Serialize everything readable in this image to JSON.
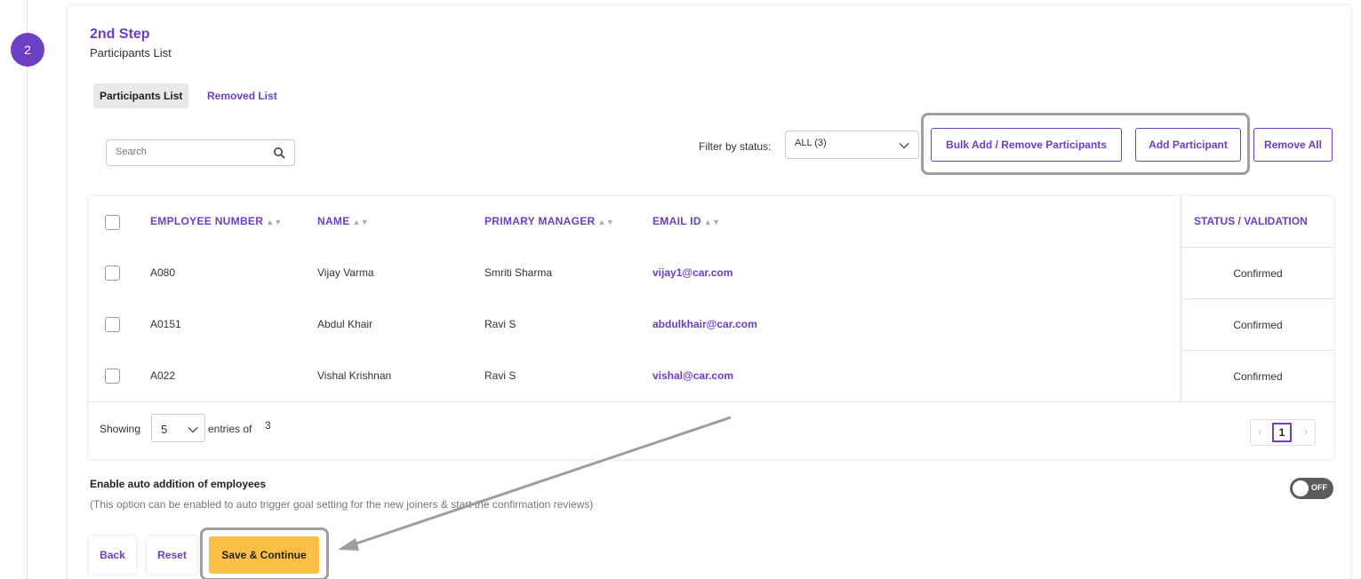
{
  "step": {
    "number": "2",
    "title": "2nd Step",
    "subtitle": "Participants List"
  },
  "tabs": [
    {
      "label": "Participants List",
      "active": true
    },
    {
      "label": "Removed List",
      "active": false
    }
  ],
  "search": {
    "placeholder": "Search",
    "value": ""
  },
  "filter": {
    "label": "Filter by status:",
    "selected": "ALL (3)"
  },
  "actions": {
    "bulk": "Bulk Add / Remove Participants",
    "add": "Add Participant",
    "remove_all": "Remove All"
  },
  "table": {
    "columns": [
      "EMPLOYEE NUMBER",
      "NAME",
      "PRIMARY MANAGER",
      "EMAIL ID"
    ],
    "status_column": "STATUS / VALIDATION",
    "rows": [
      {
        "employee_number": "A080",
        "name": "Vijay Varma",
        "manager": "Smriti Sharma",
        "email": "vijay1@car.com",
        "status": "Confirmed"
      },
      {
        "employee_number": "A0151",
        "name": "Abdul Khair",
        "manager": "Ravi S",
        "email": "abdulkhair@car.com",
        "status": "Confirmed"
      },
      {
        "employee_number": "A022",
        "name": "Vishal Krishnan",
        "manager": "Ravi S",
        "email": "vishal@car.com",
        "status": "Confirmed"
      }
    ]
  },
  "pagination": {
    "showing_label": "Showing",
    "page_size": "5",
    "entries_of_label": "entries of",
    "total": "3",
    "prev": "‹",
    "current_page": "1",
    "next": "›"
  },
  "auto_addition": {
    "title": "Enable auto addition of employees",
    "description": "(This option can be enabled to auto trigger goal setting for the new joiners & start the confirmation reviews)",
    "toggle_label": "OFF"
  },
  "footer_buttons": {
    "back": "Back",
    "reset": "Reset",
    "save": "Save & Continue"
  },
  "colors": {
    "accent": "#6c3fc4",
    "primary_button": "#fbbf45",
    "highlight_border": "#9e9e9e"
  }
}
